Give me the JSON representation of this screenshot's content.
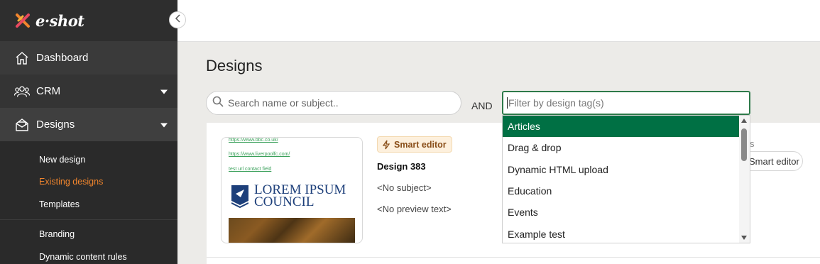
{
  "app": {
    "brand": "e·shot"
  },
  "sidebar": {
    "items": [
      {
        "label": "Dashboard",
        "icon": "home-icon"
      },
      {
        "label": "CRM",
        "icon": "users-icon"
      },
      {
        "label": "Designs",
        "icon": "envelope-icon"
      }
    ],
    "sub_items": [
      {
        "label": "New design"
      },
      {
        "label": "Existing designs",
        "active": true
      },
      {
        "label": "Templates"
      },
      {
        "label": "Branding"
      },
      {
        "label": "Dynamic content rules"
      }
    ]
  },
  "page": {
    "title": "Designs",
    "search": {
      "placeholder": "Search name or subject..",
      "value": ""
    },
    "and_label": "AND",
    "tag_filter": {
      "placeholder": "Filter by design tag(s)",
      "value": ""
    }
  },
  "tag_dropdown": {
    "options": [
      "Articles",
      "Drag & drop",
      "Dynamic HTML upload",
      "Education",
      "Events",
      "Example test"
    ],
    "selected": "Articles"
  },
  "design_card": {
    "badge": "Smart editor",
    "name": "Design 383",
    "subject": "<No subject>",
    "preview": "<No preview text>",
    "thumbnail": {
      "links": [
        "https://www.bbc.co.uk/",
        "https://www.liverpoolfc.com/",
        "test url contact field"
      ],
      "logo_line1": "LOREM IPSUM",
      "logo_line2": "COUNCIL"
    },
    "right_text": "s",
    "right_chip": "Smart editor"
  },
  "colors": {
    "sidebar_bg": "#2e2e2e",
    "accent_orange": "#f0852d",
    "selected_green": "#007044",
    "focus_green": "#2e7a4a"
  }
}
